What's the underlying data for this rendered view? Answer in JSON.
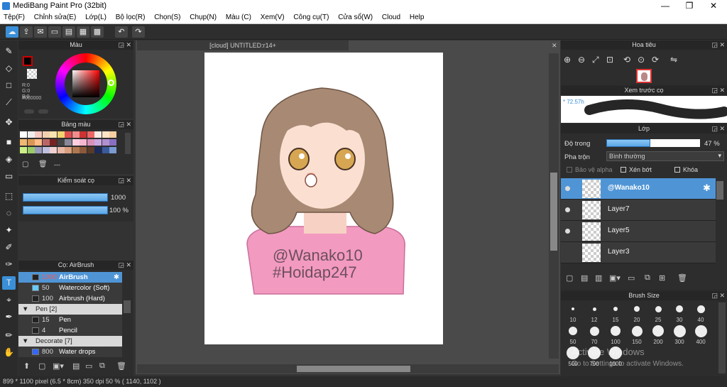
{
  "window": {
    "title": "MediBang Paint Pro (32bit)",
    "minimize": "—",
    "maximize": "❐",
    "close": "✕"
  },
  "menu": [
    "Tệp(F)",
    "Chỉnh sửa(E)",
    "Lớp(L)",
    "Bộ lọc(R)",
    "Chọn(S)",
    "Chụp(N)",
    "Màu (C)",
    "Xem(V)",
    "Công cụ(T)",
    "Cửa sổ(W)",
    "Cloud",
    "Help"
  ],
  "color_panel": {
    "title": "Màu",
    "r": "R:0",
    "g": "G:0",
    "b": "B:0",
    "hex": "#000000"
  },
  "palette_panel": {
    "title": "Bảng màu",
    "name": "---"
  },
  "brush_control": {
    "title": "Kiểm soát cọ",
    "size": "1000",
    "opacity": "100 %",
    "size_fill": 1.0,
    "opacity_fill": 1.0
  },
  "brush_panel": {
    "title": "Cọ: AirBrush",
    "items": [
      {
        "size": "1000",
        "name": "AirBrush",
        "selected": true,
        "group": false
      },
      {
        "size": "50",
        "name": "Watercolor (Soft)",
        "selected": false,
        "group": false
      },
      {
        "size": "100",
        "name": "Airbrush (Hard)",
        "selected": false,
        "group": false
      },
      {
        "size": "",
        "name": "Pen [2]",
        "selected": false,
        "group": true
      },
      {
        "size": "15",
        "name": "Pen",
        "selected": false,
        "group": false
      },
      {
        "size": "4",
        "name": "Pencil",
        "selected": false,
        "group": false
      },
      {
        "size": "",
        "name": "Decorate [7]",
        "selected": false,
        "group": true
      },
      {
        "size": "800",
        "name": "Water drops",
        "selected": false,
        "group": false
      }
    ]
  },
  "document": {
    "tab": "[cloud] UNTITLED:r14+"
  },
  "artwork": {
    "line1": "@Wanako10",
    "line2": "#Hoidap247"
  },
  "navigator": {
    "title": "Hoa tiêu"
  },
  "preview": {
    "title": "Xem trước cọ",
    "value": "* 72.57h"
  },
  "layers": {
    "title": "Lớp",
    "opacity_label": "Độ trong",
    "opacity_value": "47 %",
    "opacity_fill": 0.47,
    "blend_label": "Pha trộn",
    "blend_value": "Bình thường",
    "protect_alpha": "Bảo vệ alpha",
    "clipping": "Xén bớt",
    "lock": "Khóa",
    "items": [
      {
        "name": "@Wanako10",
        "selected": true,
        "visible": true
      },
      {
        "name": "Layer7",
        "selected": false,
        "visible": true
      },
      {
        "name": "Layer5",
        "selected": false,
        "visible": true
      },
      {
        "name": "Layer3",
        "selected": false,
        "visible": false
      }
    ]
  },
  "brush_size": {
    "title": "Brush Size",
    "sizes": [
      "10",
      "12",
      "15",
      "20",
      "25",
      "30",
      "40",
      "50",
      "70",
      "100",
      "150",
      "200",
      "300",
      "400",
      "500",
      "700",
      "1000"
    ]
  },
  "watermark": {
    "line1": "Activate Windows",
    "line2": "Go to Settings to activate Windows."
  },
  "status": "899 * 1100 pixel   (6.5 * 8cm)   350 dpi   50 %   ( 1140, 1102 )"
}
